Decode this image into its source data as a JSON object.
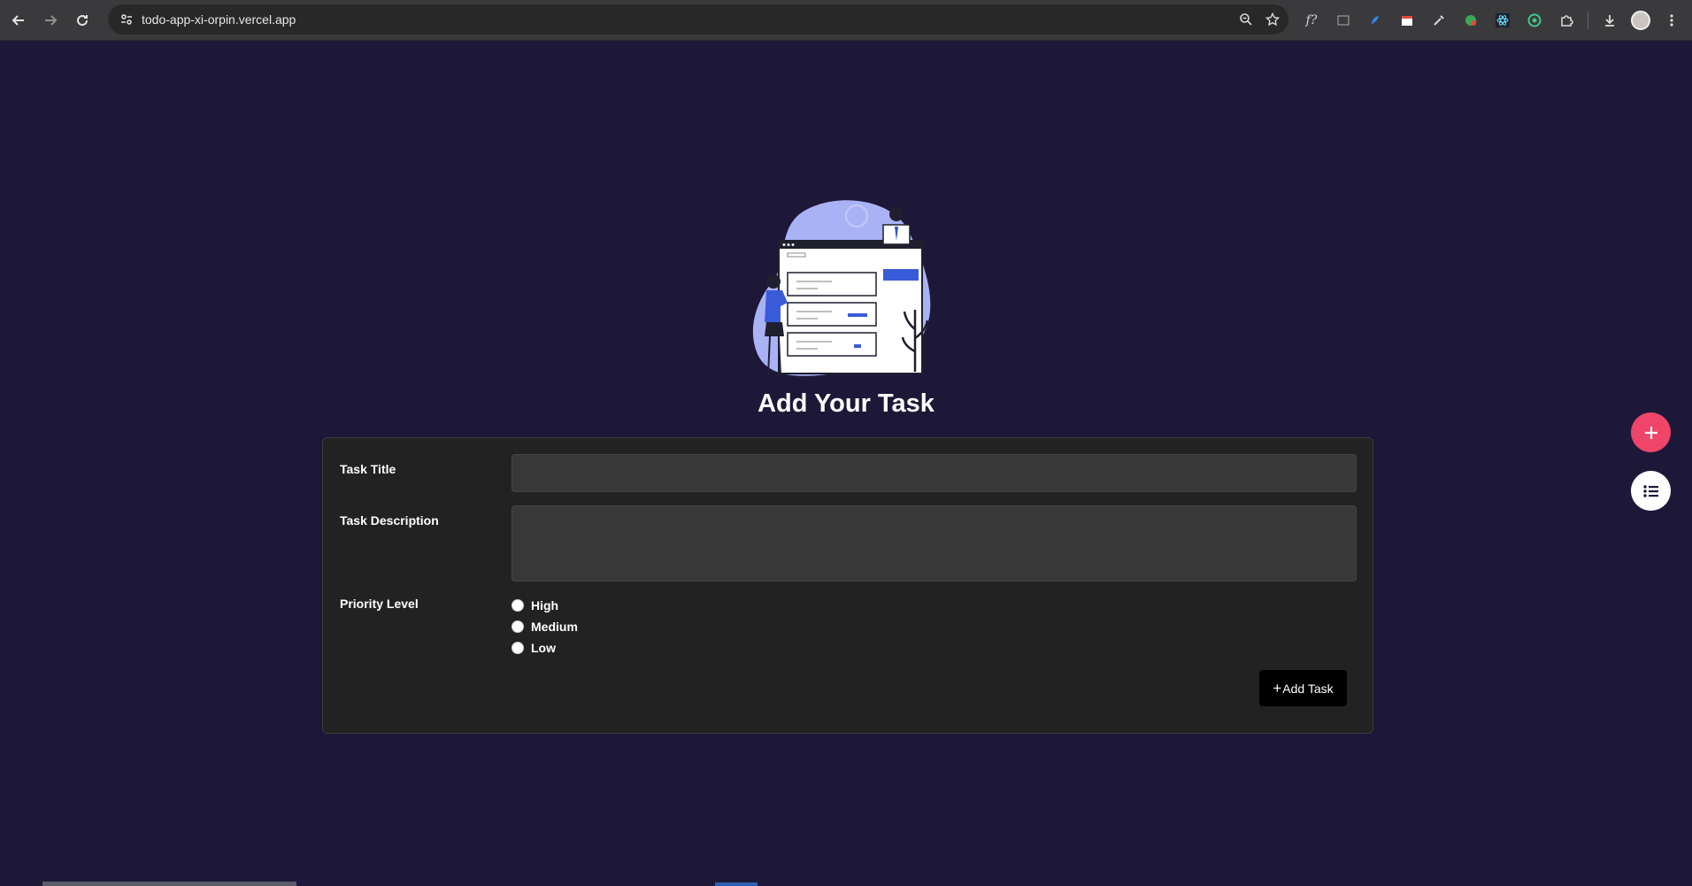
{
  "browser": {
    "url": "todo-app-xi-orpin.vercel.app",
    "icons": {
      "back": "back-arrow-icon",
      "forward": "forward-arrow-icon",
      "reload": "reload-icon",
      "site_info": "site-info-icon",
      "zoom": "zoom-icon",
      "bookmark": "star-icon",
      "downloads": "download-icon",
      "menu": "kebab-menu-icon"
    }
  },
  "page": {
    "title": "Add Your Task",
    "background": "#1d1838"
  },
  "form": {
    "title_label": "Task Title",
    "title_value": "",
    "description_label": "Task Description",
    "description_value": "",
    "priority_label": "Priority Level",
    "priorities": [
      "High",
      "Medium",
      "Low"
    ],
    "submit_label": "Add Task",
    "submit_icon": "plus-icon"
  },
  "fabs": {
    "add_color": "#ee4569",
    "add_icon": "plus-icon",
    "list_icon": "list-icon"
  }
}
